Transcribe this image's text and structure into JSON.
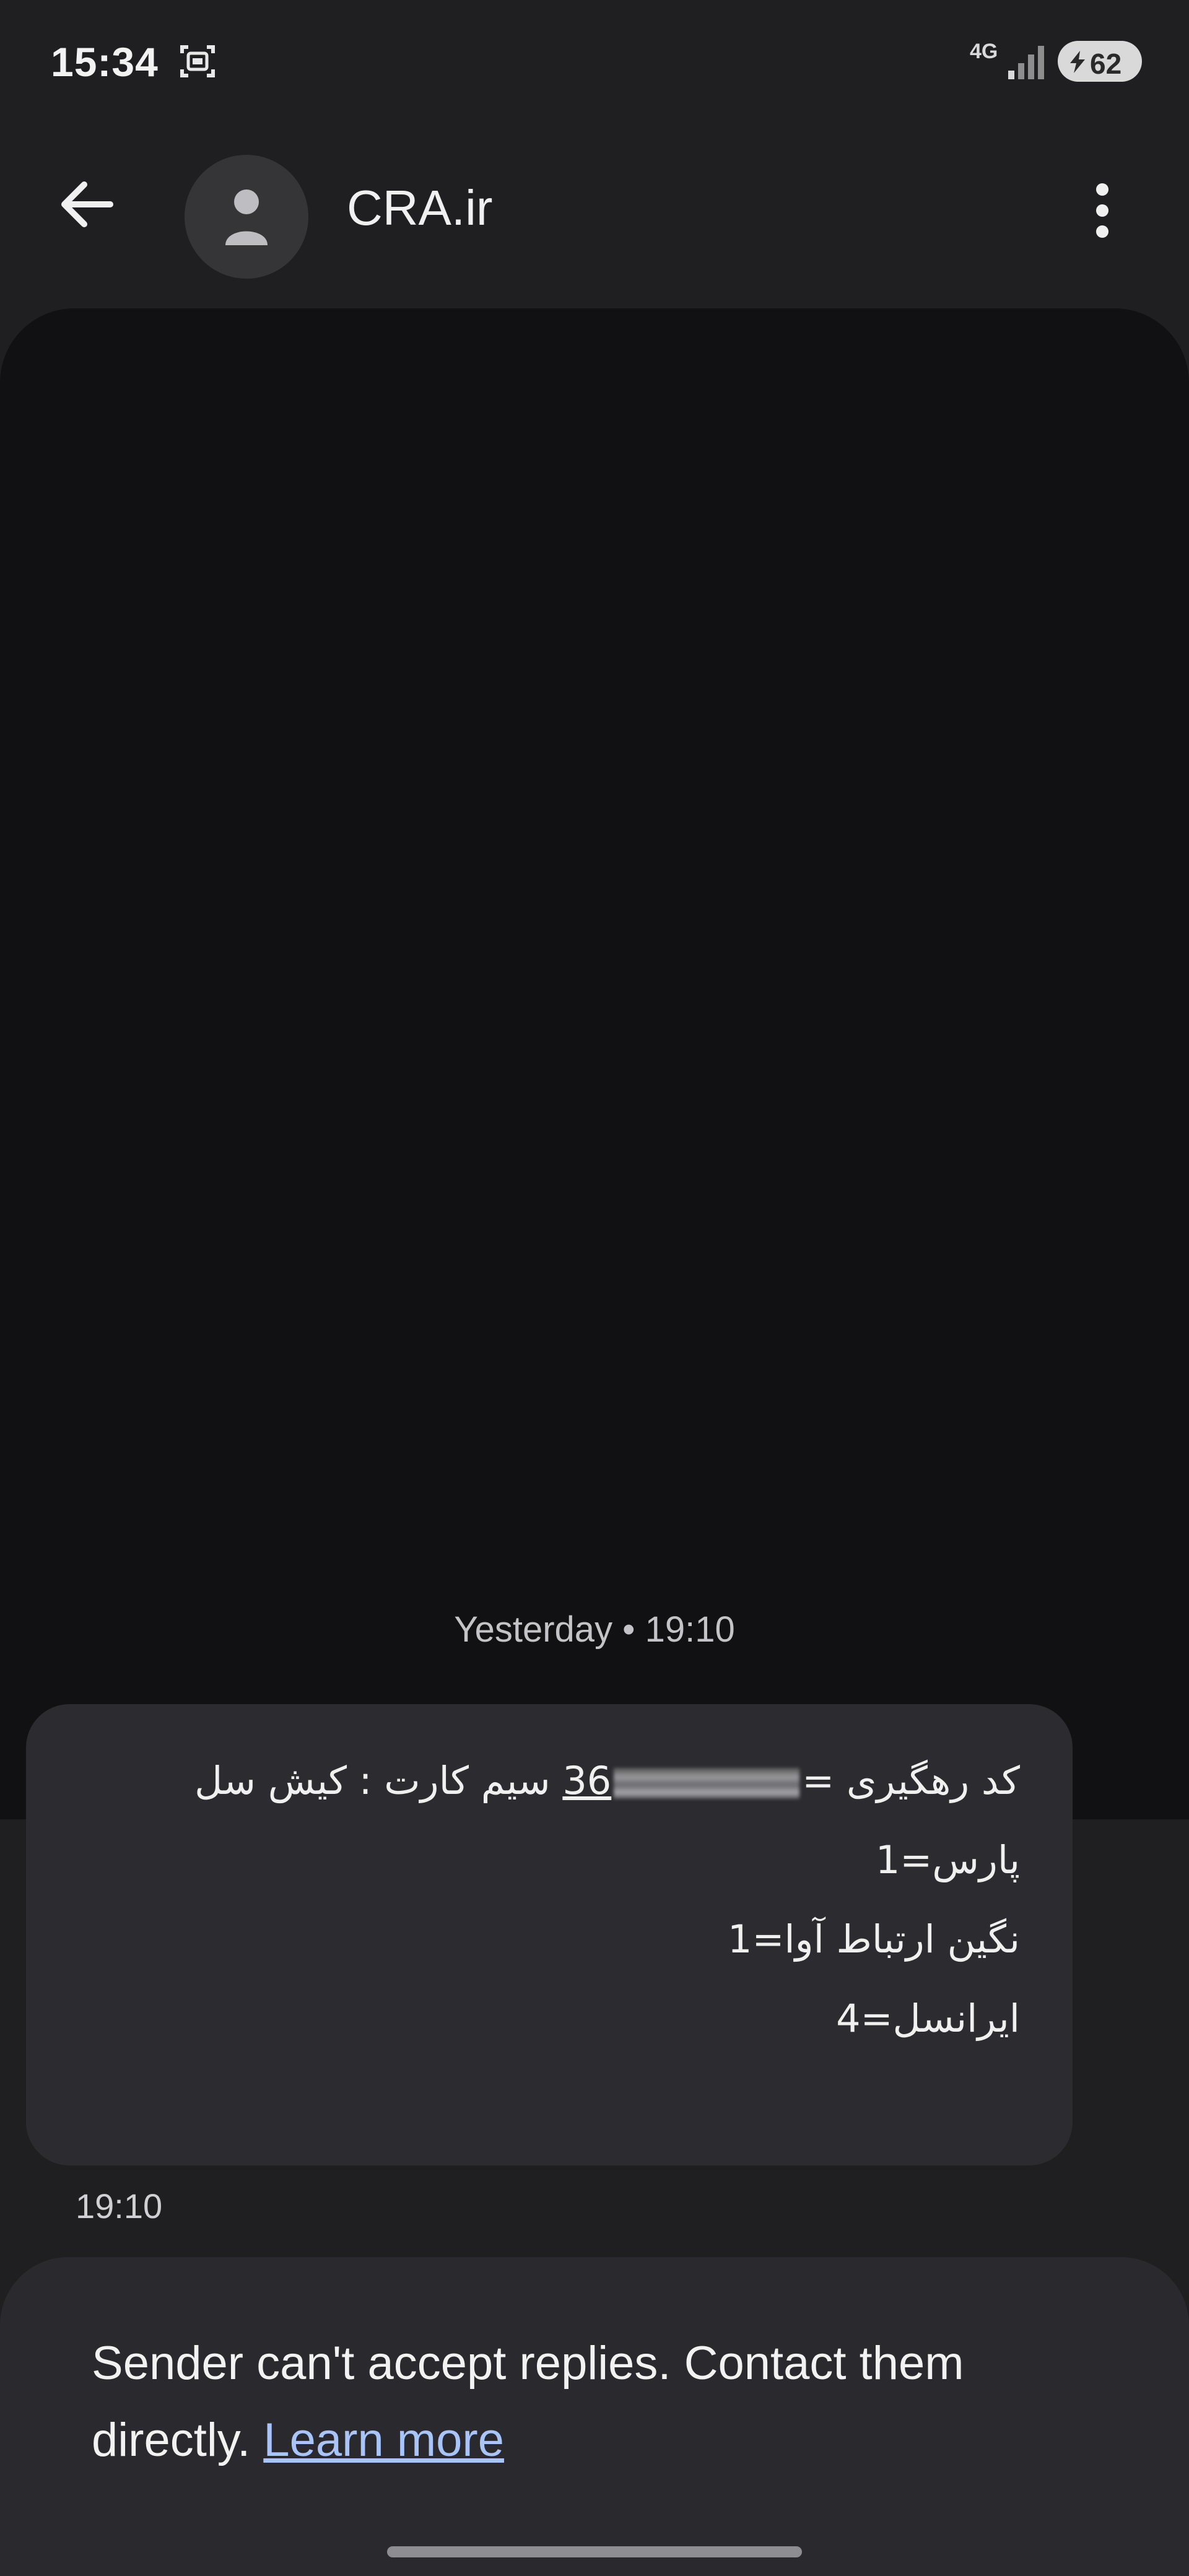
{
  "status_bar": {
    "time": "15:34",
    "network": "4G",
    "battery": "62",
    "icons": [
      "screen-record-icon",
      "signal-icon",
      "battery-charging-icon"
    ]
  },
  "header": {
    "contact_name": "CRA.ir",
    "icons": [
      "back-arrow-icon",
      "person-icon",
      "more-vert-icon"
    ]
  },
  "conversation": {
    "date_separator": "Yesterday • 19:10",
    "message": {
      "line1_a": "کد رهگیری =",
      "line1_b": "36",
      "line1_c": "سیم کارت : کیش سل",
      "line2": "پارس=1",
      "line3": "نگین ارتباط آوا=1",
      "line4": "ایرانسل=4",
      "time": "19:10"
    }
  },
  "reply_notice": {
    "text": "Sender can't accept replies. Contact them directly. ",
    "link": "Learn more"
  },
  "colors": {
    "background": "#1f1f22",
    "media_area": "#111114",
    "bubble": "#2c2c30",
    "link": "#a8c4f8"
  }
}
